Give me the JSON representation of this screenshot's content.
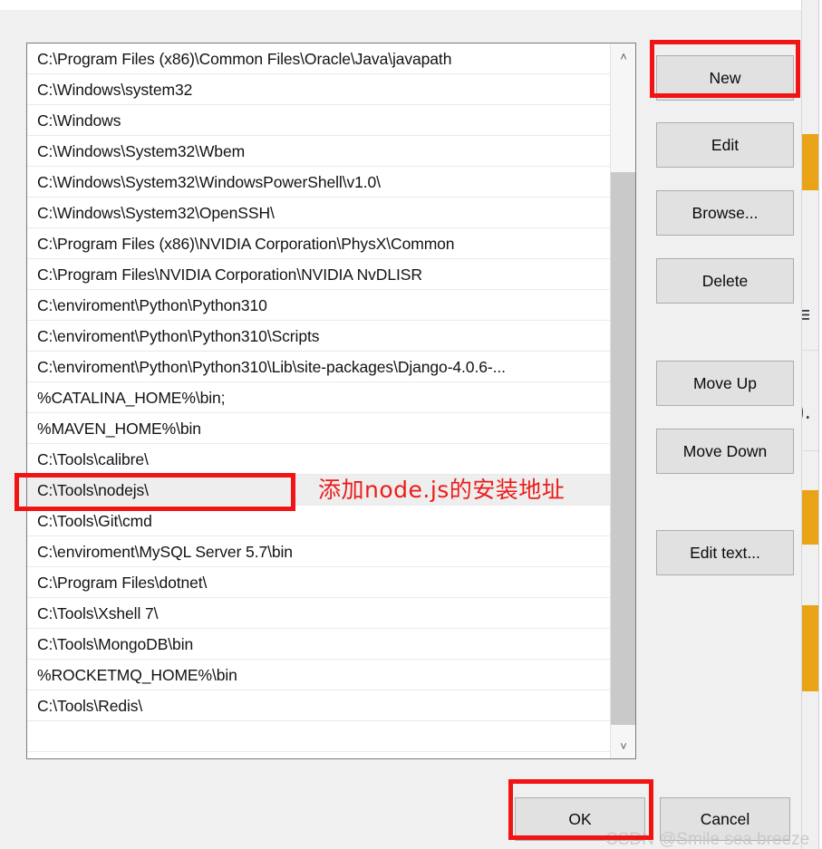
{
  "dialog": {
    "name": "edit-environment-variable"
  },
  "path_list": {
    "items": [
      "C:\\Program Files (x86)\\Common Files\\Oracle\\Java\\javapath",
      "C:\\Windows\\system32",
      "C:\\Windows",
      "C:\\Windows\\System32\\Wbem",
      "C:\\Windows\\System32\\WindowsPowerShell\\v1.0\\",
      "C:\\Windows\\System32\\OpenSSH\\",
      "C:\\Program Files (x86)\\NVIDIA Corporation\\PhysX\\Common",
      "C:\\Program Files\\NVIDIA Corporation\\NVIDIA NvDLISR",
      "C:\\enviroment\\Python\\Python310",
      "C:\\enviroment\\Python\\Python310\\Scripts",
      "C:\\enviroment\\Python\\Python310\\Lib\\site-packages\\Django-4.0.6-...",
      "%CATALINA_HOME%\\bin;",
      "%MAVEN_HOME%\\bin",
      "C:\\Tools\\calibre\\",
      "C:\\Tools\\nodejs\\",
      "C:\\Tools\\Git\\cmd",
      "C:\\enviroment\\MySQL Server 5.7\\bin",
      "C:\\Program Files\\dotnet\\",
      "C:\\Tools\\Xshell 7\\",
      "C:\\Tools\\MongoDB\\bin",
      "%ROCKETMQ_HOME%\\bin",
      "C:\\Tools\\Redis\\",
      ""
    ],
    "selected_index": 14
  },
  "scrollbar": {
    "up_arrow": "˄",
    "down_arrow": "˅"
  },
  "side_buttons": [
    {
      "id": "new",
      "label": "New"
    },
    {
      "id": "edit",
      "label": "Edit"
    },
    {
      "id": "browse",
      "label": "Browse..."
    },
    {
      "id": "delete",
      "label": "Delete"
    },
    {
      "id": "move_up",
      "label": "Move Up"
    },
    {
      "id": "move_down",
      "label": "Move Down"
    },
    {
      "id": "edit_text",
      "label": "Edit text..."
    }
  ],
  "bottom_buttons": [
    {
      "id": "ok",
      "label": "OK"
    },
    {
      "id": "cancel",
      "label": "Cancel"
    }
  ],
  "annotation": {
    "text": "添加node.js的安装地址",
    "color": "#ec1c1c"
  },
  "highlights": {
    "color": "#f11414",
    "targets": [
      "new-button",
      "nodejs-row",
      "ok-button"
    ]
  },
  "watermark": {
    "text": "CSDN @Smile sea breeze"
  },
  "colors": {
    "dialog_bg": "#f0f0f0",
    "list_bg": "#ffffff",
    "button_bg": "#e1e1e1",
    "button_border": "#adadad",
    "selected_row": "#eeeeee",
    "accent_red": "#f11414",
    "background_window_orange": "#e8a317"
  }
}
